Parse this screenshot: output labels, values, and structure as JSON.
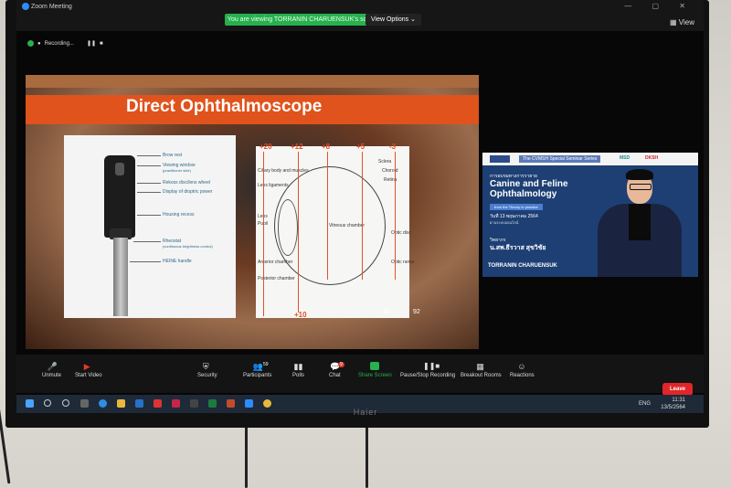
{
  "zoom": {
    "window_title": "Zoom Meeting",
    "viewing_banner": "You are viewing TORRANIN CHARUENSUK's screen",
    "view_options": "View Options ⌄",
    "view_button": "View",
    "recording": "Recording..."
  },
  "slide": {
    "title": "Direct Ophthalmoscope",
    "left_labels": [
      "Brow rest",
      "Viewing window",
      "(practitioner side)",
      "Rekoss disc/lens wheel",
      "Display of dioptric power",
      "Housing recess",
      "Rheostat",
      "(continuous brightness control)",
      "HEINE handle"
    ],
    "eye_labels": [
      "Ciliary body and muscles",
      "Lens ligaments",
      "Lens",
      "Pupil",
      "Vitreous chamber",
      "Sclera",
      "Choroid",
      "Retina",
      "Optic disc",
      "Anterior chamber",
      "Posterior chamber",
      "Optic nerve"
    ],
    "red_numbers": [
      "+20",
      "+12",
      "+8",
      "+5",
      "-3",
      "+10"
    ],
    "white_numbers": [
      "82",
      "92"
    ]
  },
  "webinar": {
    "series_tag": "The CVMSH Special Seminar Series",
    "logos": [
      "MSD",
      "DKSH"
    ],
    "thai_heading": "การอบรมทางการรายาย",
    "title_line1": "Canine and Feline",
    "title_line2": "Ophthalmology",
    "pill": "from the Theory to practice",
    "date": "วันที่ 13 พฤษภาคม 2564",
    "venue": "ผ่านระบบออนไลน์",
    "speaker_title": "วิทยากร",
    "speaker_name": "น.สพ.ธีรวาส สุขวิชัย",
    "name_label": "TORRANIN CHARUENSUK"
  },
  "toolbar": {
    "unmute": "Unmute",
    "start_video": "Start Video",
    "security": "Security",
    "participants": "Participants",
    "participants_count": "59",
    "polls": "Polls",
    "chat": "Chat",
    "chat_badge": "9",
    "share_screen": "Share Screen",
    "pause_recording": "Pause/Stop Recording",
    "breakout": "Breakout Rooms",
    "reactions": "Reactions",
    "leave": "Leave"
  },
  "taskbar": {
    "lang": "ENG",
    "time": "11:31",
    "date": "13/5/2564"
  },
  "tv_brand": "Haier",
  "colors": {
    "accent_orange": "#e0531c",
    "banner_green": "#27b14e",
    "leave_red": "#e0262a",
    "webinar_blue": "#1d3f74"
  }
}
